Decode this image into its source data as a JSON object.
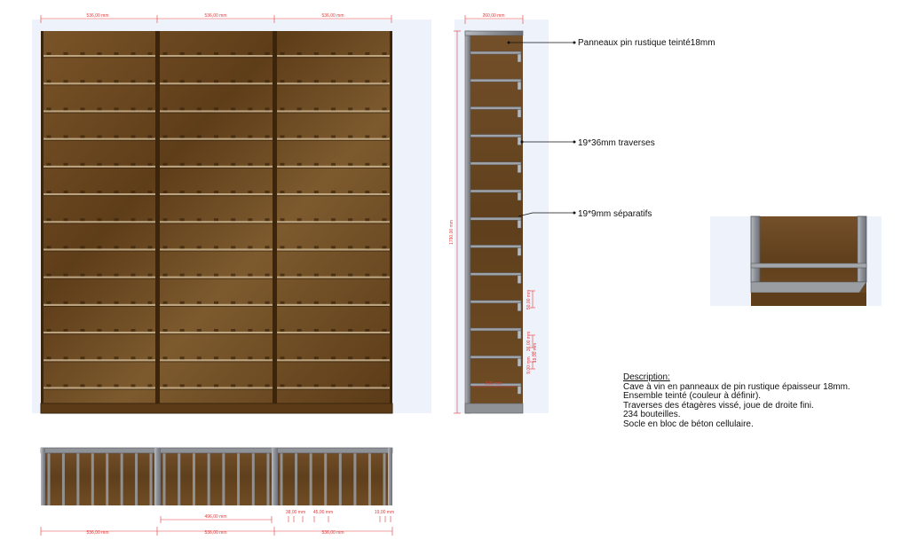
{
  "dimensions": {
    "front_widths": [
      "536,00 mm",
      "536,00 mm",
      "536,00 mm"
    ],
    "side_depth": "260,00 mm",
    "height": "1790,00 mm",
    "side_small": [
      "50,00 mm",
      "36,00 mm",
      "19,00 mm",
      "9,00 mm"
    ],
    "side_bottom": "2,00 mm",
    "top_view_inner": "496,00 mm",
    "top_view_widths": [
      "536,00 mm",
      "536,00 mm",
      "536,00 mm"
    ],
    "top_view_small": [
      "38,00 mm",
      "45,00 mm",
      "19,00 mm"
    ]
  },
  "callouts": {
    "panels": "Panneaux pin rustique teinté18mm",
    "traverses": "19*36mm traverses",
    "separators": "19*9mm séparatifs"
  },
  "description": {
    "title": "Description:",
    "lines": [
      "Cave à vin en panneaux de pin rustique épaisseur 18mm.",
      "Ensemble teinté (couleur à définir).",
      "Traverses des étagères vissé, joue de droite fini.",
      "234 bouteilles.",
      "Socle en bloc de béton cellulaire."
    ]
  },
  "colors": {
    "wood": "#6e4a22",
    "wood_dark": "#4a2f12",
    "frame_gray": "#8f9297",
    "dimension_red": "#e23a3a",
    "panel_bg": "#eef3fb"
  }
}
